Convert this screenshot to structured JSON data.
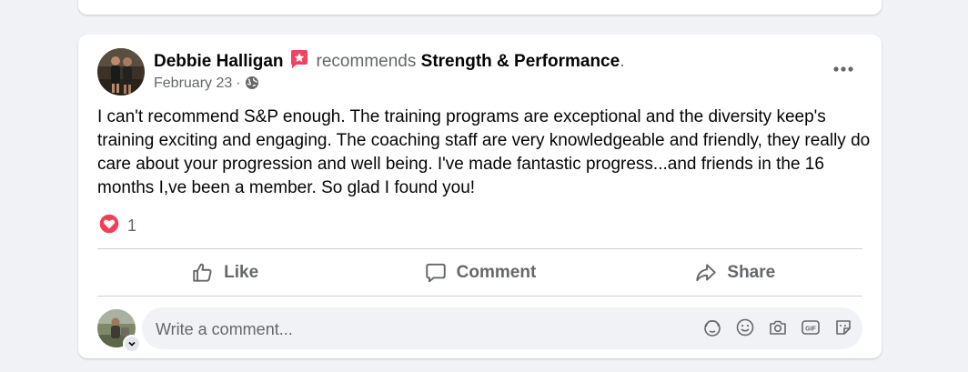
{
  "post": {
    "author_name": "Debbie Halligan",
    "verb": "recommends",
    "page_name": "Strength & Performance",
    "trailing_punct": ".",
    "date": "February 23",
    "separator": "·",
    "privacy_icon": "globe-icon",
    "text": "I can't recommend S&P enough. The training programs are exceptional and the diversity keep's training exciting and engaging. The coaching staff are very knowledgeable and friendly, they really do care about your progression and well being. I've made fantastic progress...and friends in the 16 months I,ve been a member. So glad I found you!",
    "reaction_icon": "love-reaction-icon",
    "reaction_count": "1"
  },
  "actions": {
    "like_label": "Like",
    "comment_label": "Comment",
    "share_label": "Share"
  },
  "comment_box": {
    "placeholder": "Write a comment...",
    "tools": [
      "avatar-sticker-icon",
      "emoji-icon",
      "camera-icon",
      "gif-icon",
      "sticker-icon"
    ]
  },
  "colors": {
    "background": "#f0f2f5",
    "card": "#ffffff",
    "secondary_text": "#65676b",
    "divider": "#ced0d4",
    "recommend_badge": "#f3425f",
    "love_reaction": "#f33e58"
  }
}
